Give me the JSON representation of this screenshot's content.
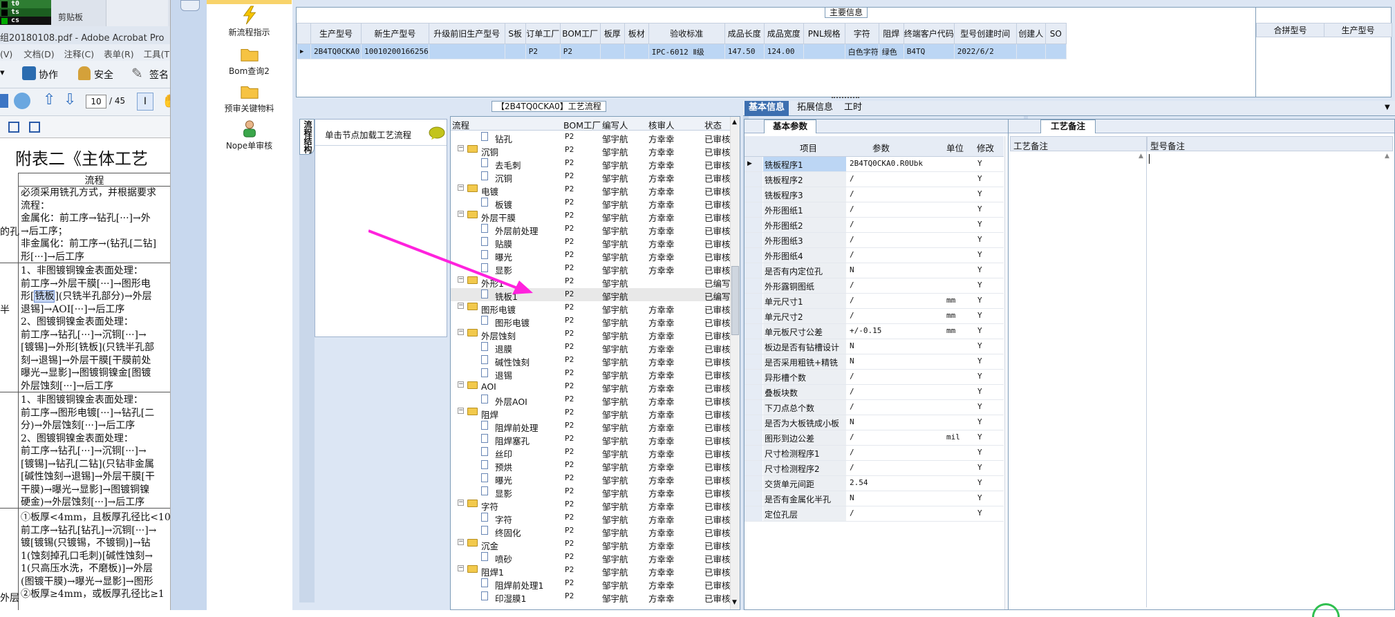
{
  "excel": {
    "cells": [
      "t0",
      "ts",
      "cs"
    ],
    "clipboard": "剪贴板"
  },
  "acrobat": {
    "title": "组20180108.pdf - Adobe Acrobat Pro",
    "menu": [
      "(V)",
      "文档(D)",
      "注释(C)",
      "表单(R)",
      "工具(T)"
    ],
    "tools": {
      "collab": "协作",
      "security": "安全",
      "sign": "签名"
    },
    "page_current": "10",
    "page_total": "/ 45",
    "doc_heading": "附表二《主体工艺",
    "col_header": "流程",
    "blocks": [
      {
        "side": "的孔",
        "lines": [
          "必须采用铣孔方式，并根据要求",
          "流程：",
          "金属化：前工序→钻孔[···]→外",
          "→后工序；",
          "非金属化：前工序→(钻孔[二钻]",
          "形[···]→后工序"
        ]
      },
      {
        "side": "半",
        "lines": [
          "1、非图镀铜镍金表面处理：",
          "前工序→外层干膜[···]→图形电",
          "形[铣板](只铣半孔部分)→外层",
          "退锡]→AOI[···]→后工序",
          "2、图镀铜镍金表面处理：",
          "前工序→钻孔[···]→沉铜[···]→",
          "[镀锡]→外形[铣板](只铣半孔部",
          "刻→退锡]→外层干膜[干膜前处",
          "曝光→显影]→图镀铜镍金[图镀",
          "外层蚀刻[···]→后工序"
        ]
      },
      {
        "side": "",
        "lines": [
          "1、非图镀铜镍金表面处理：",
          "前工序→图形电镀[···]→钻孔[二",
          "分)→外层蚀刻[···]→后工序",
          "2、图镀铜镍金表面处理：",
          "前工序→钻孔[···]→沉铜[···]→",
          "[镀锡]→钻孔[二钻](只钻非金属",
          "[碱性蚀刻→退锡]→外层干膜[干",
          "干膜)→曝光→显影]→图镀铜镍",
          "硬金)→外层蚀刻[···]→后工序"
        ]
      },
      {
        "side": "外层",
        "lines": [
          "①板厚<4mm，且板厚孔径比<10:",
          "前工序→钻孔[钻孔]→沉铜[···]→",
          "镀[镀锡(只镀锡，不镀铜)]→钻",
          "1(蚀刻掉孔口毛刺)[碱性蚀刻→",
          "1(只高压水洗，不磨板)]→外层",
          "(图镀干膜)→曝光→显影]→图形",
          "②板厚≥4mm，或板厚孔径比≥1"
        ]
      }
    ]
  },
  "launcher": {
    "items": [
      "新流程指示",
      "Bom查询2",
      "预审关键物料",
      "Nope单审核"
    ]
  },
  "main_info": {
    "title": "主要信息",
    "columns": [
      "生产型号",
      "新生产型号",
      "升级前旧生产型号",
      "S板",
      "订单工厂",
      "BOM工厂",
      "板厚",
      "板材",
      "验收标准",
      "成品长度",
      "成品宽度",
      "PNL规格",
      "字符",
      "阻焊",
      "终端客户代码",
      "型号创建时间",
      "创建人",
      "SO"
    ],
    "row": [
      "2B4TQ0CKA0",
      "10010200166256",
      "",
      "",
      "P2",
      "P2",
      "",
      "",
      "IPC-6012 Ⅱ级",
      "147.50",
      "124.00",
      "",
      "白色字符",
      "绿色",
      "B4TQ",
      "2022/6/2",
      "",
      ""
    ],
    "side_columns": [
      "合拼型号",
      "生产型号"
    ]
  },
  "flow": {
    "title": "【2B4TQ0CKA0】工艺流程",
    "load_hint": "单击节点加载工艺流程",
    "vtab": "流程结构",
    "columns": [
      "流程",
      "BOM工厂",
      "编写人",
      "核审人",
      "状态"
    ],
    "rows": [
      {
        "level": 2,
        "kind": "file",
        "name": "钻孔",
        "bom": "P2",
        "writer": "邹宇航",
        "reviewer": "方幸幸",
        "status": "已审核"
      },
      {
        "level": 1,
        "kind": "folder",
        "name": "沉铜",
        "bom": "P2",
        "writer": "邹宇航",
        "reviewer": "方幸幸",
        "status": "已审核"
      },
      {
        "level": 2,
        "kind": "file",
        "name": "去毛刺",
        "bom": "P2",
        "writer": "邹宇航",
        "reviewer": "方幸幸",
        "status": "已审核"
      },
      {
        "level": 2,
        "kind": "file",
        "name": "沉铜",
        "bom": "P2",
        "writer": "邹宇航",
        "reviewer": "方幸幸",
        "status": "已审核"
      },
      {
        "level": 1,
        "kind": "folder",
        "name": "电镀",
        "bom": "P2",
        "writer": "邹宇航",
        "reviewer": "方幸幸",
        "status": "已审核"
      },
      {
        "level": 2,
        "kind": "file",
        "name": "板镀",
        "bom": "P2",
        "writer": "邹宇航",
        "reviewer": "方幸幸",
        "status": "已审核"
      },
      {
        "level": 1,
        "kind": "folder",
        "name": "外层干膜",
        "bom": "P2",
        "writer": "邹宇航",
        "reviewer": "方幸幸",
        "status": "已审核"
      },
      {
        "level": 2,
        "kind": "file",
        "name": "外层前处理",
        "bom": "P2",
        "writer": "邹宇航",
        "reviewer": "方幸幸",
        "status": "已审核"
      },
      {
        "level": 2,
        "kind": "file",
        "name": "贴膜",
        "bom": "P2",
        "writer": "邹宇航",
        "reviewer": "方幸幸",
        "status": "已审核"
      },
      {
        "level": 2,
        "kind": "file",
        "name": "曝光",
        "bom": "P2",
        "writer": "邹宇航",
        "reviewer": "方幸幸",
        "status": "已审核"
      },
      {
        "level": 2,
        "kind": "file",
        "name": "显影",
        "bom": "P2",
        "writer": "邹宇航",
        "reviewer": "方幸幸",
        "status": "已审核"
      },
      {
        "level": 1,
        "kind": "folder",
        "name": "外形1",
        "bom": "P2",
        "writer": "邹宇航",
        "reviewer": "",
        "status": "已编写"
      },
      {
        "level": 2,
        "kind": "file",
        "name": "铣板1",
        "bom": "P2",
        "writer": "邹宇航",
        "reviewer": "",
        "status": "已编写",
        "selected": true
      },
      {
        "level": 1,
        "kind": "folder",
        "name": "图形电镀",
        "bom": "P2",
        "writer": "邹宇航",
        "reviewer": "方幸幸",
        "status": "已审核"
      },
      {
        "level": 2,
        "kind": "file",
        "name": "图形电镀",
        "bom": "P2",
        "writer": "邹宇航",
        "reviewer": "方幸幸",
        "status": "已审核"
      },
      {
        "level": 1,
        "kind": "folder",
        "name": "外层蚀刻",
        "bom": "P2",
        "writer": "邹宇航",
        "reviewer": "方幸幸",
        "status": "已审核"
      },
      {
        "level": 2,
        "kind": "file",
        "name": "退膜",
        "bom": "P2",
        "writer": "邹宇航",
        "reviewer": "方幸幸",
        "status": "已审核"
      },
      {
        "level": 2,
        "kind": "file",
        "name": "碱性蚀刻",
        "bom": "P2",
        "writer": "邹宇航",
        "reviewer": "方幸幸",
        "status": "已审核"
      },
      {
        "level": 2,
        "kind": "file",
        "name": "退锡",
        "bom": "P2",
        "writer": "邹宇航",
        "reviewer": "方幸幸",
        "status": "已审核"
      },
      {
        "level": 1,
        "kind": "folder",
        "name": "AOI",
        "bom": "P2",
        "writer": "邹宇航",
        "reviewer": "方幸幸",
        "status": "已审核"
      },
      {
        "level": 2,
        "kind": "file",
        "name": "外层AOI",
        "bom": "P2",
        "writer": "邹宇航",
        "reviewer": "方幸幸",
        "status": "已审核"
      },
      {
        "level": 1,
        "kind": "folder",
        "name": "阻焊",
        "bom": "P2",
        "writer": "邹宇航",
        "reviewer": "方幸幸",
        "status": "已审核"
      },
      {
        "level": 2,
        "kind": "file",
        "name": "阻焊前处理",
        "bom": "P2",
        "writer": "邹宇航",
        "reviewer": "方幸幸",
        "status": "已审核"
      },
      {
        "level": 2,
        "kind": "file",
        "name": "阻焊塞孔",
        "bom": "P2",
        "writer": "邹宇航",
        "reviewer": "方幸幸",
        "status": "已审核"
      },
      {
        "level": 2,
        "kind": "file",
        "name": "丝印",
        "bom": "P2",
        "writer": "邹宇航",
        "reviewer": "方幸幸",
        "status": "已审核"
      },
      {
        "level": 2,
        "kind": "file",
        "name": "预烘",
        "bom": "P2",
        "writer": "邹宇航",
        "reviewer": "方幸幸",
        "status": "已审核"
      },
      {
        "level": 2,
        "kind": "file",
        "name": "曝光",
        "bom": "P2",
        "writer": "邹宇航",
        "reviewer": "方幸幸",
        "status": "已审核"
      },
      {
        "level": 2,
        "kind": "file",
        "name": "显影",
        "bom": "P2",
        "writer": "邹宇航",
        "reviewer": "方幸幸",
        "status": "已审核"
      },
      {
        "level": 1,
        "kind": "folder",
        "name": "字符",
        "bom": "P2",
        "writer": "邹宇航",
        "reviewer": "方幸幸",
        "status": "已审核"
      },
      {
        "level": 2,
        "kind": "file",
        "name": "字符",
        "bom": "P2",
        "writer": "邹宇航",
        "reviewer": "方幸幸",
        "status": "已审核"
      },
      {
        "level": 2,
        "kind": "file",
        "name": "终固化",
        "bom": "P2",
        "writer": "邹宇航",
        "reviewer": "方幸幸",
        "status": "已审核"
      },
      {
        "level": 1,
        "kind": "folder",
        "name": "沉金",
        "bom": "P2",
        "writer": "邹宇航",
        "reviewer": "方幸幸",
        "status": "已审核"
      },
      {
        "level": 2,
        "kind": "file",
        "name": "喷砂",
        "bom": "P2",
        "writer": "邹宇航",
        "reviewer": "方幸幸",
        "status": "已审核"
      },
      {
        "level": 1,
        "kind": "folder",
        "name": "阻焊1",
        "bom": "P2",
        "writer": "邹宇航",
        "reviewer": "方幸幸",
        "status": "已审核"
      },
      {
        "level": 2,
        "kind": "file",
        "name": "阻焊前处理1",
        "bom": "P2",
        "writer": "邹宇航",
        "reviewer": "方幸幸",
        "status": "已审核"
      },
      {
        "level": 2,
        "kind": "file",
        "name": "印湿膜1",
        "bom": "P2",
        "writer": "邹宇航",
        "reviewer": "方幸幸",
        "status": "已审核"
      }
    ]
  },
  "tabs": [
    "基本信息",
    "拓展信息",
    "工时"
  ],
  "basic_params": {
    "title": "基本参数",
    "columns": [
      "项目",
      "参数",
      "单位",
      "修改"
    ],
    "rows": [
      {
        "item": "铣板程序1",
        "value": "2B4TQ0CKA0.R0Ubk",
        "unit": "",
        "mod": "Y",
        "selected": true
      },
      {
        "item": "铣板程序2",
        "value": "/",
        "unit": "",
        "mod": "Y"
      },
      {
        "item": "铣板程序3",
        "value": "/",
        "unit": "",
        "mod": "Y"
      },
      {
        "item": "外形图纸1",
        "value": "/",
        "unit": "",
        "mod": "Y"
      },
      {
        "item": "外形图纸2",
        "value": "/",
        "unit": "",
        "mod": "Y"
      },
      {
        "item": "外形图纸3",
        "value": "/",
        "unit": "",
        "mod": "Y"
      },
      {
        "item": "外形图纸4",
        "value": "/",
        "unit": "",
        "mod": "Y"
      },
      {
        "item": "是否有内定位孔",
        "value": "N",
        "unit": "",
        "mod": "Y"
      },
      {
        "item": "外形露铜图纸",
        "value": "/",
        "unit": "",
        "mod": "Y"
      },
      {
        "item": "单元尺寸1",
        "value": "/",
        "unit": "mm",
        "mod": "Y"
      },
      {
        "item": "单元尺寸2",
        "value": "/",
        "unit": "mm",
        "mod": "Y"
      },
      {
        "item": "单元板尺寸公差",
        "value": "+/-0.15",
        "unit": "mm",
        "mod": "Y"
      },
      {
        "item": "板边是否有钻槽设计",
        "value": "N",
        "unit": "",
        "mod": "Y"
      },
      {
        "item": "是否采用粗铣+精铣",
        "value": "N",
        "unit": "",
        "mod": "Y"
      },
      {
        "item": "异形槽个数",
        "value": "/",
        "unit": "",
        "mod": "Y"
      },
      {
        "item": "叠板块数",
        "value": "/",
        "unit": "",
        "mod": "Y"
      },
      {
        "item": "下刀点总个数",
        "value": "/",
        "unit": "",
        "mod": "Y"
      },
      {
        "item": "是否为大板铣成小板",
        "value": "N",
        "unit": "",
        "mod": "Y"
      },
      {
        "item": "图形到边公差",
        "value": "/",
        "unit": "mil",
        "mod": "Y"
      },
      {
        "item": "尺寸检测程序1",
        "value": "/",
        "unit": "",
        "mod": "Y"
      },
      {
        "item": "尺寸检测程序2",
        "value": "/",
        "unit": "",
        "mod": "Y"
      },
      {
        "item": "交货单元间距",
        "value": "2.54",
        "unit": "",
        "mod": "Y"
      },
      {
        "item": "是否有金属化半孔",
        "value": "N",
        "unit": "",
        "mod": "Y"
      },
      {
        "item": "定位孔层",
        "value": "/",
        "unit": "",
        "mod": "Y"
      }
    ]
  },
  "remarks": {
    "title": "工艺备注",
    "columns": [
      "工艺备注",
      "型号备注"
    ]
  },
  "colors": {
    "arrow": "#ff22dd",
    "selected": "#bcd6f4",
    "tab_active": "#3d6fb0",
    "panel_bg": "#dce6f4"
  }
}
